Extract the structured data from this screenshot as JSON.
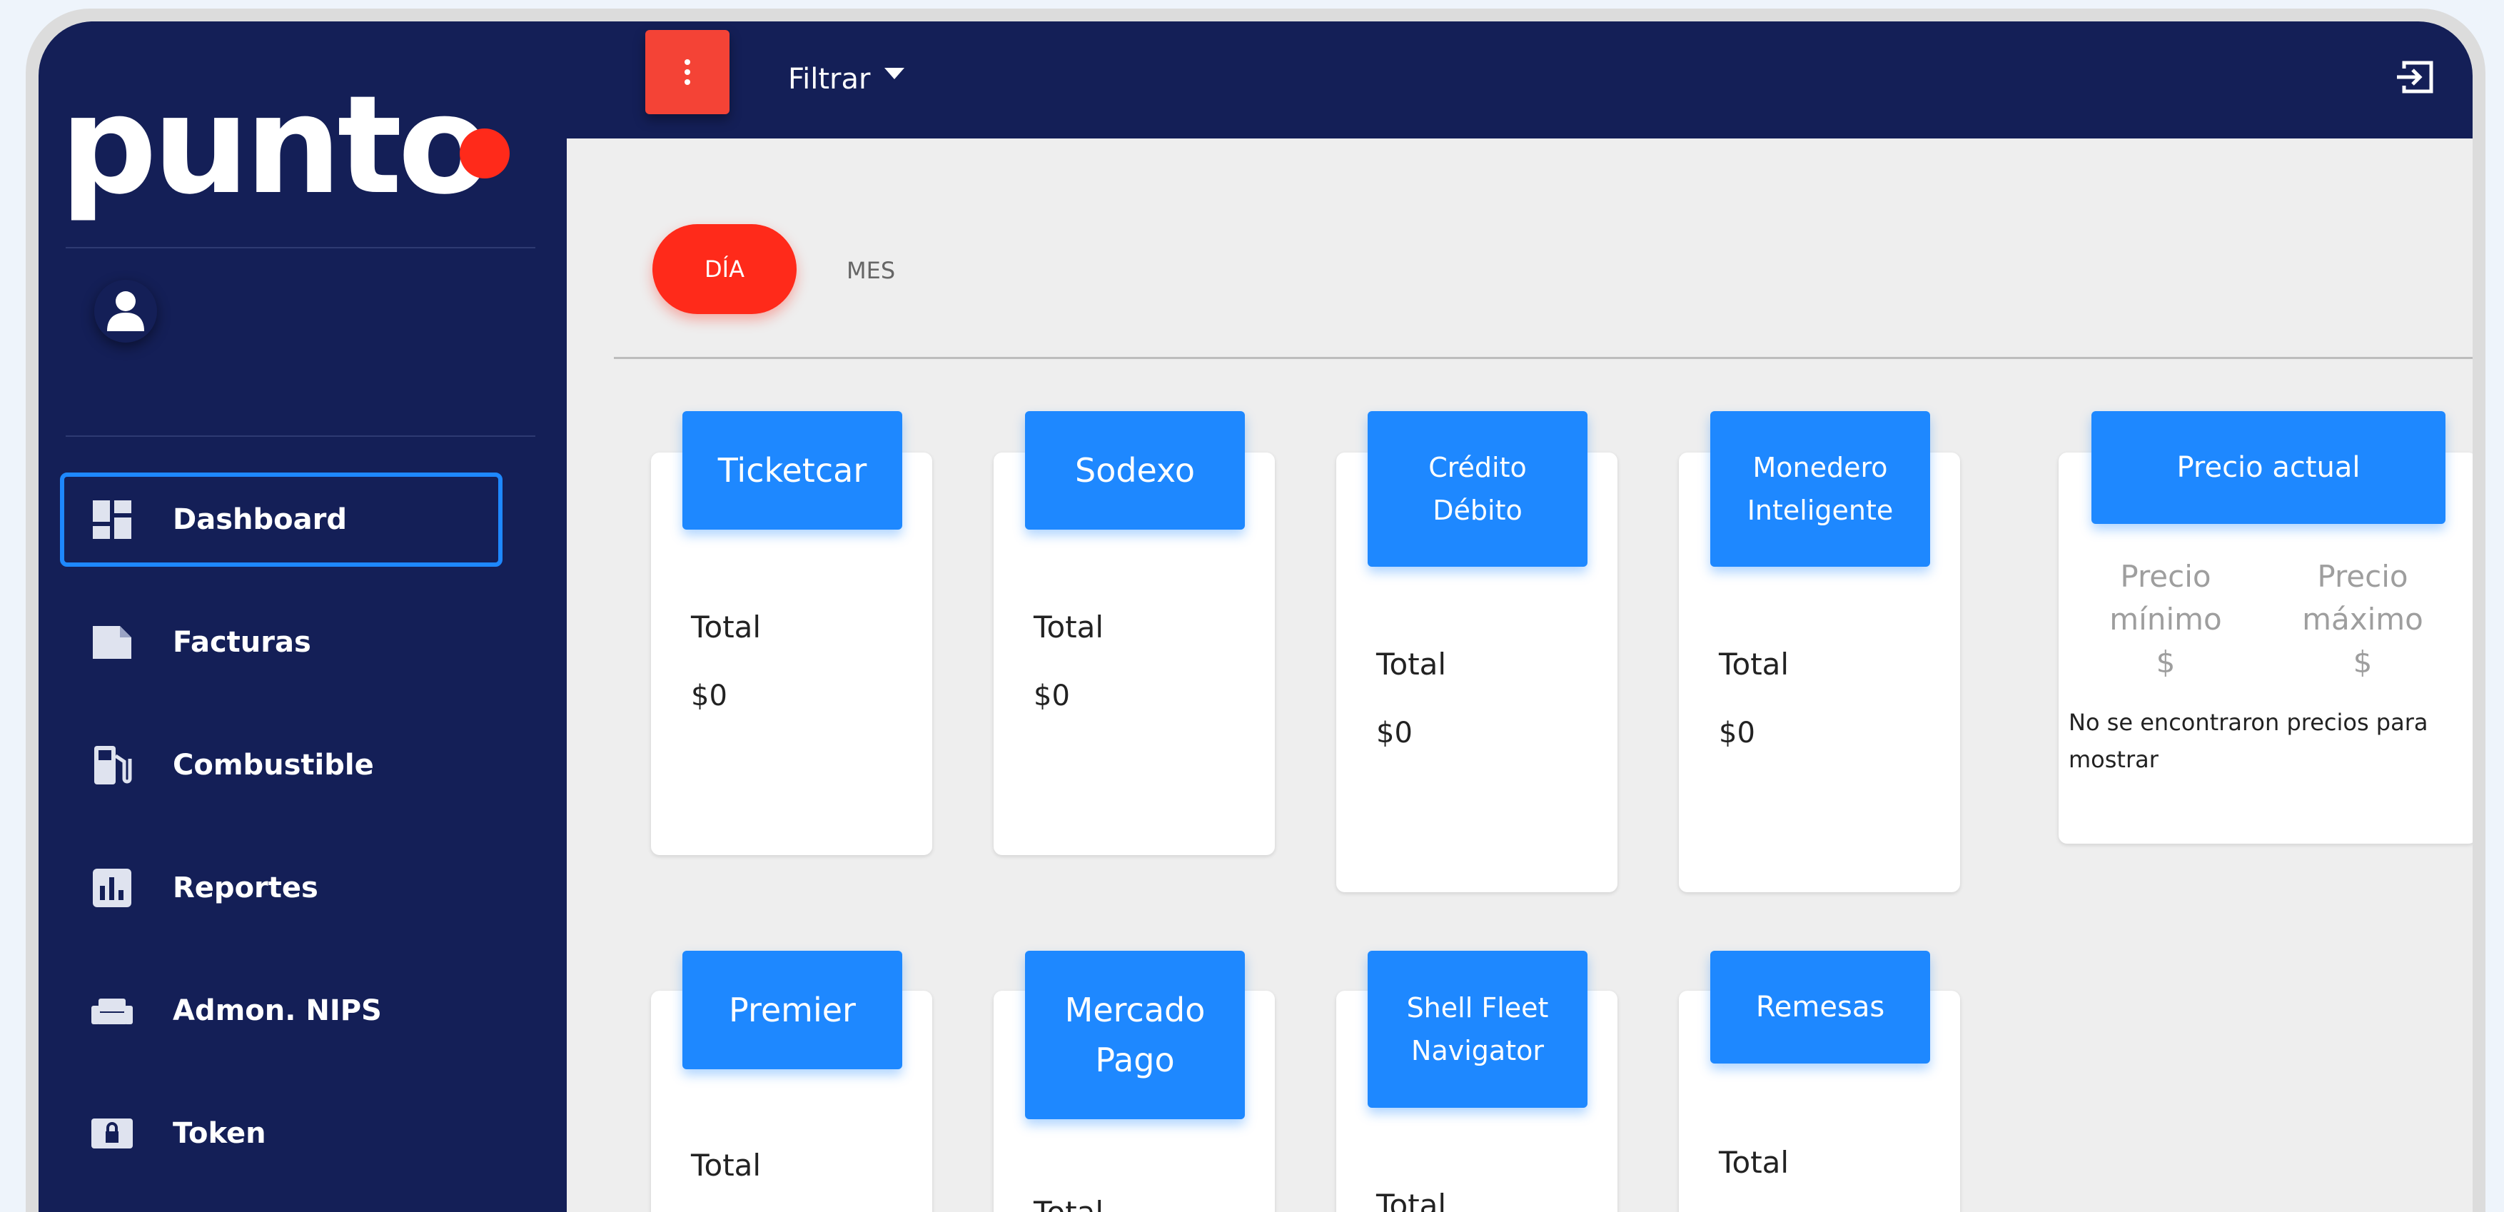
{
  "brand": {
    "logo_text": "punto"
  },
  "sidebar": {
    "items": [
      {
        "label": "Dashboard"
      },
      {
        "label": "Facturas"
      },
      {
        "label": "Combustible"
      },
      {
        "label": "Reportes"
      },
      {
        "label": "Admon. NIPS"
      },
      {
        "label": "Token"
      }
    ]
  },
  "topbar": {
    "filter_label": "Filtrar"
  },
  "tabs": {
    "day": "DÍA",
    "month": "MES"
  },
  "cards": [
    {
      "title": "Ticketcar",
      "total_label": "Total",
      "total_value": "$0"
    },
    {
      "title": "Sodexo",
      "total_label": "Total",
      "total_value": "$0"
    },
    {
      "title_line1": "Crédito",
      "title_line2": "Débito",
      "total_label": "Total",
      "total_value": "$0"
    },
    {
      "title_line1": "Monedero",
      "title_line2": "Inteligente",
      "total_label": "Total",
      "total_value": "$0"
    },
    {
      "title": "Premier",
      "total_label": "Total"
    },
    {
      "title_line1": "Mercado",
      "title_line2": "Pago",
      "total_label": "Total"
    },
    {
      "title_line1": "Shell Fleet",
      "title_line2": "Navigator",
      "total_label": "Total"
    },
    {
      "title": "Remesas",
      "total_label": "Total"
    }
  ],
  "price_card": {
    "title": "Precio actual",
    "min_line1": "Precio",
    "min_line2": "mínimo",
    "min_value": "$",
    "max_line1": "Precio",
    "max_line2": "máximo",
    "max_value": "$",
    "empty_line1": "No se encontraron precios para",
    "empty_line2": "mostrar"
  },
  "colors": {
    "sidebar_bg": "#141f57",
    "accent_red": "#ff2a1a",
    "card_header_blue": "#1e88ff",
    "content_bg": "#eeeeee"
  },
  "icons": {
    "menu": "more-vertical-icon",
    "logout": "logout-icon",
    "user": "user-icon"
  }
}
